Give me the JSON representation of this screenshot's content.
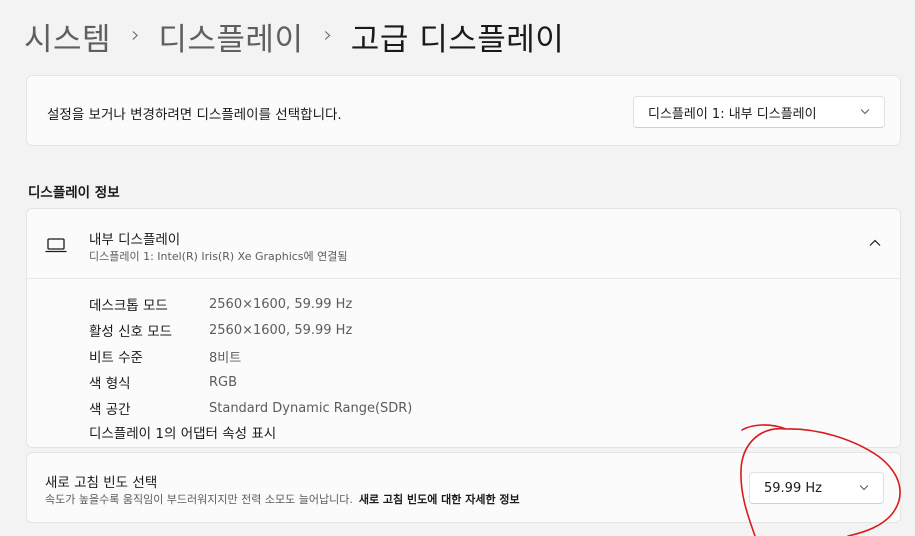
{
  "breadcrumb": {
    "items": [
      "시스템",
      "디스플레이"
    ],
    "current": "고급 디스플레이",
    "separator": "›"
  },
  "display_select": {
    "prompt": "설정을 보거나 변경하려면 디스플레이를 선택합니다.",
    "selected": "디스플레이 1: 내부 디스플레이"
  },
  "display_info": {
    "section_title": "디스플레이 정보",
    "title": "내부 디스플레이",
    "subtitle": "디스플레이 1: Intel(R) Iris(R) Xe Graphics에 연결됨",
    "properties": [
      {
        "label": "데스크톱 모드",
        "value": "2560×1600, 59.99 Hz"
      },
      {
        "label": "활성 신호 모드",
        "value": "2560×1600, 59.99 Hz"
      },
      {
        "label": "비트 수준",
        "value": "8비트"
      },
      {
        "label": "색 형식",
        "value": "RGB"
      },
      {
        "label": "색 공간",
        "value": "Standard Dynamic Range(SDR)"
      }
    ],
    "adapter_link": "디스플레이 1의 어댑터 속성 표시"
  },
  "refresh_rate": {
    "title": "새로 고침 빈도 선택",
    "subtitle": "속도가 높을수록 움직임이 부드러워지지만 전력 소모도 늘어납니다.",
    "link": "새로 고침 빈도에 대한 자세한 정보",
    "selected": "59.99 Hz"
  },
  "icons": {
    "display": "laptop-icon",
    "collapse": "chevron-up-icon",
    "dropdown": "chevron-down-icon"
  },
  "colors": {
    "background": "#f3f3f3",
    "card": "#fbfbfb",
    "annotation": "#d81b1b"
  }
}
